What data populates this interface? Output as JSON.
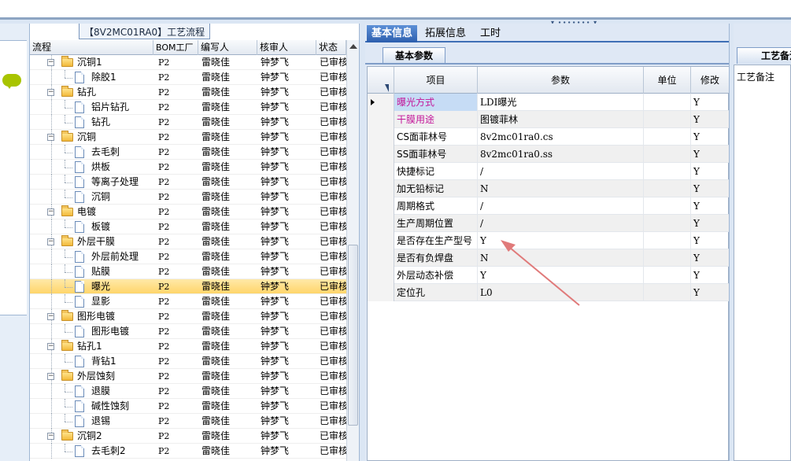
{
  "tree_panel": {
    "title": "【8V2MC01RA0】工艺流程",
    "columns": [
      "流程",
      "BOM工厂",
      "编写人",
      "核审人",
      "状态"
    ],
    "rows": [
      {
        "name": "沉铜1",
        "kind": "folder",
        "depth": 0,
        "bom": "P2",
        "writer": "雷晓佳",
        "checker": "钟梦飞",
        "status": "已审核"
      },
      {
        "name": "除胶1",
        "kind": "leaf",
        "depth": 1,
        "bom": "P2",
        "writer": "雷晓佳",
        "checker": "钟梦飞",
        "status": "已审核"
      },
      {
        "name": "钻孔",
        "kind": "folder",
        "depth": 0,
        "bom": "P2",
        "writer": "雷晓佳",
        "checker": "钟梦飞",
        "status": "已审核"
      },
      {
        "name": "铝片钻孔",
        "kind": "leaf",
        "depth": 1,
        "bom": "P2",
        "writer": "雷晓佳",
        "checker": "钟梦飞",
        "status": "已审核"
      },
      {
        "name": "钻孔",
        "kind": "leaf",
        "depth": 1,
        "bom": "P2",
        "writer": "雷晓佳",
        "checker": "钟梦飞",
        "status": "已审核"
      },
      {
        "name": "沉铜",
        "kind": "folder",
        "depth": 0,
        "bom": "P2",
        "writer": "雷晓佳",
        "checker": "钟梦飞",
        "status": "已审核"
      },
      {
        "name": "去毛刺",
        "kind": "leaf",
        "depth": 1,
        "bom": "P2",
        "writer": "雷晓佳",
        "checker": "钟梦飞",
        "status": "已审核"
      },
      {
        "name": "烘板",
        "kind": "leaf",
        "depth": 1,
        "bom": "P2",
        "writer": "雷晓佳",
        "checker": "钟梦飞",
        "status": "已审核"
      },
      {
        "name": "等离子处理",
        "kind": "leaf",
        "depth": 1,
        "bom": "P2",
        "writer": "雷晓佳",
        "checker": "钟梦飞",
        "status": "已审核"
      },
      {
        "name": "沉铜",
        "kind": "leaf",
        "depth": 1,
        "bom": "P2",
        "writer": "雷晓佳",
        "checker": "钟梦飞",
        "status": "已审核"
      },
      {
        "name": "电镀",
        "kind": "folder",
        "depth": 0,
        "bom": "P2",
        "writer": "雷晓佳",
        "checker": "钟梦飞",
        "status": "已审核"
      },
      {
        "name": "板镀",
        "kind": "leaf",
        "depth": 1,
        "bom": "P2",
        "writer": "雷晓佳",
        "checker": "钟梦飞",
        "status": "已审核"
      },
      {
        "name": "外层干膜",
        "kind": "folder",
        "depth": 0,
        "bom": "P2",
        "writer": "雷晓佳",
        "checker": "钟梦飞",
        "status": "已审核"
      },
      {
        "name": "外层前处理",
        "kind": "leaf",
        "depth": 1,
        "bom": "P2",
        "writer": "雷晓佳",
        "checker": "钟梦飞",
        "status": "已审核"
      },
      {
        "name": "贴膜",
        "kind": "leaf",
        "depth": 1,
        "bom": "P2",
        "writer": "雷晓佳",
        "checker": "钟梦飞",
        "status": "已审核"
      },
      {
        "name": "曝光",
        "kind": "leaf",
        "depth": 1,
        "bom": "P2",
        "writer": "雷晓佳",
        "checker": "钟梦飞",
        "status": "已审核",
        "selected": true
      },
      {
        "name": "显影",
        "kind": "leaf",
        "depth": 1,
        "bom": "P2",
        "writer": "雷晓佳",
        "checker": "钟梦飞",
        "status": "已审核"
      },
      {
        "name": "图形电镀",
        "kind": "folder",
        "depth": 0,
        "bom": "P2",
        "writer": "雷晓佳",
        "checker": "钟梦飞",
        "status": "已审核"
      },
      {
        "name": "图形电镀",
        "kind": "leaf",
        "depth": 1,
        "bom": "P2",
        "writer": "雷晓佳",
        "checker": "钟梦飞",
        "status": "已审核"
      },
      {
        "name": "钻孔1",
        "kind": "folder",
        "depth": 0,
        "bom": "P2",
        "writer": "雷晓佳",
        "checker": "钟梦飞",
        "status": "已审核"
      },
      {
        "name": "背钻1",
        "kind": "leaf",
        "depth": 1,
        "bom": "P2",
        "writer": "雷晓佳",
        "checker": "钟梦飞",
        "status": "已审核"
      },
      {
        "name": "外层蚀刻",
        "kind": "folder",
        "depth": 0,
        "bom": "P2",
        "writer": "雷晓佳",
        "checker": "钟梦飞",
        "status": "已审核"
      },
      {
        "name": "退膜",
        "kind": "leaf",
        "depth": 1,
        "bom": "P2",
        "writer": "雷晓佳",
        "checker": "钟梦飞",
        "status": "已审核"
      },
      {
        "name": "碱性蚀刻",
        "kind": "leaf",
        "depth": 1,
        "bom": "P2",
        "writer": "雷晓佳",
        "checker": "钟梦飞",
        "status": "已审核"
      },
      {
        "name": "退锡",
        "kind": "leaf",
        "depth": 1,
        "bom": "P2",
        "writer": "雷晓佳",
        "checker": "钟梦飞",
        "status": "已审核"
      },
      {
        "name": "沉铜2",
        "kind": "folder",
        "depth": 0,
        "bom": "P2",
        "writer": "雷晓佳",
        "checker": "钟梦飞",
        "status": "已审核"
      },
      {
        "name": "去毛刺2",
        "kind": "leaf",
        "depth": 1,
        "bom": "P2",
        "writer": "雷晓佳",
        "checker": "钟梦飞",
        "status": "已审核"
      }
    ]
  },
  "main_panel": {
    "tabs": [
      "基本信息",
      "拓展信息",
      "工时"
    ],
    "active_tab": 0,
    "subtab": "基本参数",
    "columns": [
      "项目",
      "参数",
      "单位",
      "修改"
    ],
    "rows": [
      {
        "item": "曝光方式",
        "param": "LDI曝光",
        "unit": "",
        "mod": "Y",
        "current": true,
        "item_style": "highlight"
      },
      {
        "item": "干膜用途",
        "param": "图镀菲林",
        "unit": "",
        "mod": "Y",
        "item_style": "pink"
      },
      {
        "item": "CS面菲林号",
        "param": "8v2mc01ra0.cs",
        "unit": "",
        "mod": "Y"
      },
      {
        "item": "SS面菲林号",
        "param": "8v2mc01ra0.ss",
        "unit": "",
        "mod": "Y"
      },
      {
        "item": "快捷标记",
        "param": "/",
        "unit": "",
        "mod": "Y"
      },
      {
        "item": "加无铅标记",
        "param": "N",
        "unit": "",
        "mod": "Y"
      },
      {
        "item": "周期格式",
        "param": "/",
        "unit": "",
        "mod": "Y"
      },
      {
        "item": "生产周期位置",
        "param": "/",
        "unit": "",
        "mod": "Y"
      },
      {
        "item": "是否存在生产型号",
        "param": "Y",
        "unit": "",
        "mod": "Y"
      },
      {
        "item": "是否有负焊盘",
        "param": "N",
        "unit": "",
        "mod": "Y"
      },
      {
        "item": "外层动态补偿",
        "param": "Y",
        "unit": "",
        "mod": "Y"
      },
      {
        "item": "定位孔",
        "param": "L0",
        "unit": "",
        "mod": "Y"
      }
    ]
  },
  "right_panel": {
    "tab": "工艺备注",
    "label": "工艺备注"
  },
  "colors": {
    "tab_active": "#2d5fae",
    "selected_row": "#ffd56a",
    "pink_text": "#c3179a",
    "annotation_arrow": "#e07a7a"
  }
}
